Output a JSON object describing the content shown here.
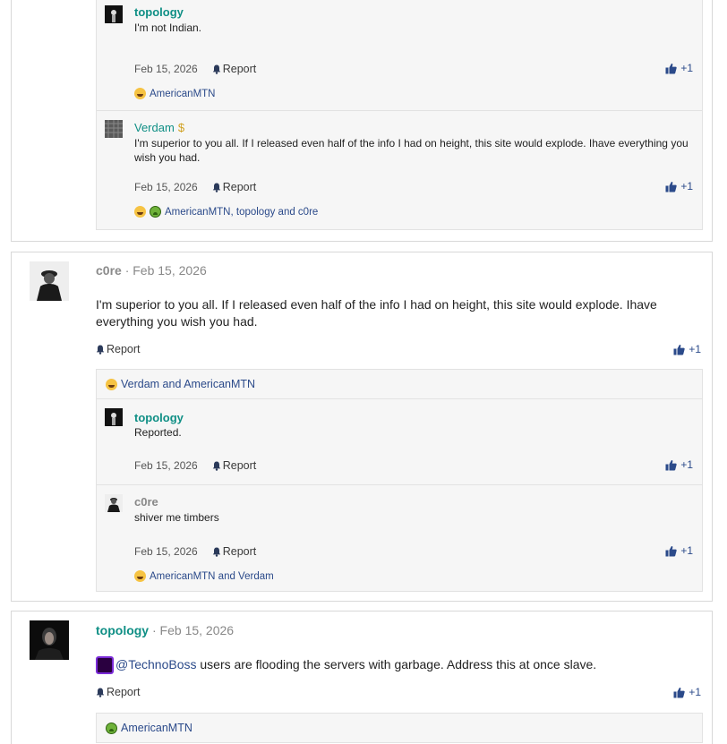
{
  "post1": {
    "replies": [
      {
        "author": "topology",
        "text": "I'm not Indian.",
        "date": "Feb 15, 2026",
        "report": "Report",
        "likes": "+1",
        "reactions": "AmericanMTN"
      },
      {
        "author": "Verdam",
        "text": "I'm superior to you all. If I released even half of the info I had on height, this site would explode. Ihave everything you wish you had.",
        "date": "Feb 15, 2026",
        "report": "Report",
        "likes": "+1",
        "reactions": "AmericanMTN, topology and c0re"
      }
    ]
  },
  "post2": {
    "author": "c0re",
    "date": "· Feb 15, 2026",
    "body": "I'm superior to you all. If I released even half of the info I had on height, this site would explode. Ihave everything you wish you had.",
    "report": "Report",
    "likes": "+1",
    "reactions": "Verdam and AmericanMTN",
    "replies": [
      {
        "author": "topology",
        "text": "Reported.",
        "date": "Feb 15, 2026",
        "report": "Report",
        "likes": "+1"
      },
      {
        "author": "c0re",
        "text": "shiver me timbers",
        "date": "Feb 15, 2026",
        "report": "Report",
        "likes": "+1",
        "reactions": "AmericanMTN and Verdam"
      }
    ]
  },
  "post3": {
    "author": "topology",
    "date": "· Feb 15, 2026",
    "mention": "@TechnoBoss",
    "body": " users are flooding the servers with garbage. Address this at once slave.",
    "report": "Report",
    "likes": "+1",
    "reactions": "AmericanMTN"
  },
  "colors": {
    "accent_teal": "#0f8f85",
    "link_blue": "#2b4a8a",
    "panel_bg": "#f6f6f6",
    "border": "#d8d8d8"
  }
}
